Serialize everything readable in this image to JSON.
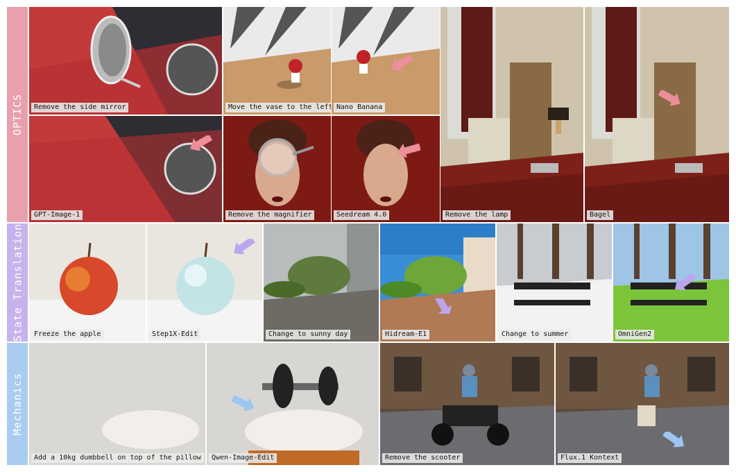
{
  "bands": [
    {
      "label": "OPTICS",
      "color": "#e9a0ad"
    },
    {
      "label": "State Translation",
      "color": "#c7b3ec"
    },
    {
      "label": "Mechanics",
      "color": "#a9ccf0"
    }
  ],
  "captions": {
    "t1": "Remove the side mirror",
    "t2": "GPT-Image-1",
    "t3": "Move the vase to the left",
    "t4": "Nano Banana",
    "t5": "Remove the magnifier",
    "t6": "Seedream 4.0",
    "t7": "Remove the lamp",
    "t8": "Bagel",
    "t9": "Freeze the apple",
    "t10": "Step1X-Edit",
    "t11": "Change to sunny day",
    "t12": "Hidream-E1",
    "t13": "Change to summer",
    "t14": "OmniGen2",
    "t15": "Add a 10kg dumbbell on top of the pillow",
    "t16": "Qwen-Image-Edit",
    "t17": "Remove the scooter",
    "t18": "Flux.1 Kontext"
  },
  "arrow_colors": {
    "pink": "#ee8e9c",
    "purple": "#bba6ee",
    "blue": "#9cc6f2"
  }
}
